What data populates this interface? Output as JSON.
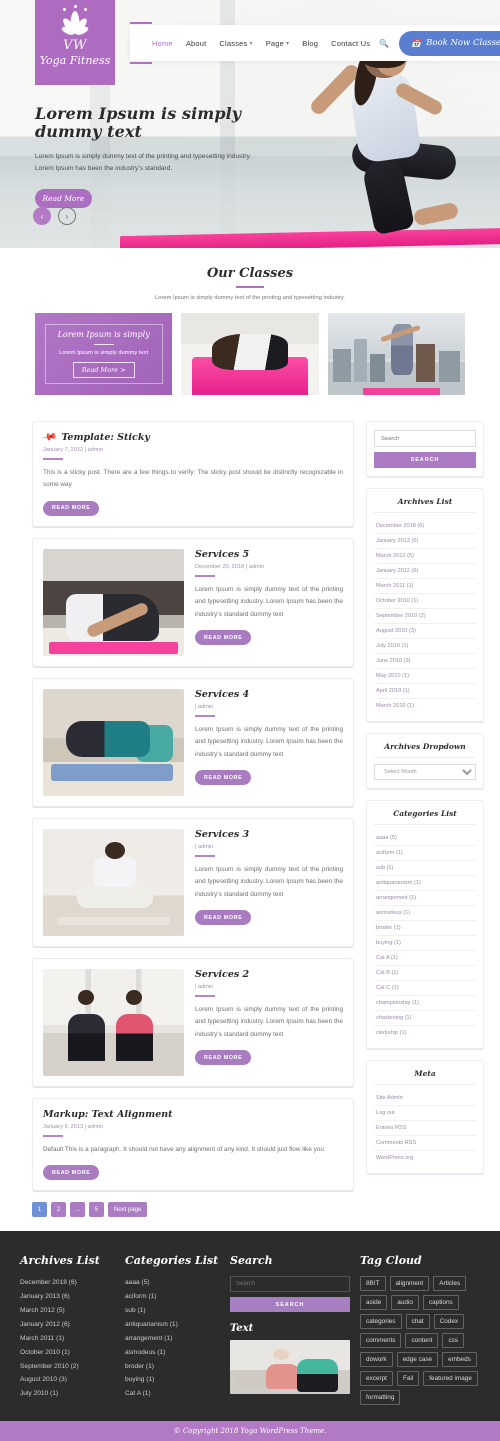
{
  "site": {
    "logo_line1": "VW",
    "logo_line2": "Yoga Fitness",
    "logo_icon": "lotus-icon"
  },
  "nav": {
    "items": [
      {
        "label": "Home",
        "active": true,
        "has_caret": false
      },
      {
        "label": "About",
        "active": false,
        "has_caret": false
      },
      {
        "label": "Classes",
        "active": false,
        "has_caret": true
      },
      {
        "label": "Page",
        "active": false,
        "has_caret": true
      },
      {
        "label": "Blog",
        "active": false,
        "has_caret": false
      },
      {
        "label": "Contact Us",
        "active": false,
        "has_caret": false
      }
    ],
    "search_icon": "search-icon",
    "cta_label": "Book Now Classes",
    "cta_icon": "calendar-icon",
    "cta_color": "#5a7fd0",
    "active_color": "#b06fc4"
  },
  "hero": {
    "title": "Lorem Ipsum is simply dummy text",
    "sub_line1": "Lorem Ipsum is simply dummy text of the printing and typesetting industry.",
    "sub_line2": "Lorem Ipsum has been the industry's standard.",
    "button": "Read More",
    "prev_icon": "chevron-left-icon",
    "next_icon": "chevron-right-icon"
  },
  "classes": {
    "title": "Our Classes",
    "subtitle": "Lorem Ipsum is simply dummy text of the printing and typesetting industry.",
    "card": {
      "title": "Lorem Ipsum is simply",
      "subtitle": "Lorem Ipsum is simply dummy text",
      "button": "Read More >"
    }
  },
  "posts": [
    {
      "sticky": true,
      "icon": "pin-icon",
      "title": "Template: Sticky",
      "meta": "January 7, 2012 |  admin",
      "body": "This is a sticky post. There are a few things to verify: The sticky post should be distinctly recognizable in some way",
      "read_more": "READ MORE",
      "thumb": null
    },
    {
      "sticky": false,
      "title": "Services 5",
      "meta": "December 20, 2018 | admin",
      "body": "Lorem Ipsum is simply dummy text of the printing and typesetting industry. Lorem Ipsum has been the industry's standard dummy text",
      "read_more": "READ MORE",
      "thumb": "yoga-stretch-on-sofa-photo"
    },
    {
      "sticky": false,
      "title": "Services 4",
      "meta": "| admin",
      "body": "Lorem Ipsum is simply dummy text of the printing and typesetting industry. Lorem Ipsum has been the industry's standard dummy text",
      "read_more": "READ MORE",
      "thumb": "yoga-side-stretch-photo"
    },
    {
      "sticky": false,
      "title": "Services 3",
      "meta": "| admin",
      "body": "Lorem Ipsum is simply dummy text of the printing and typesetting industry. Lorem Ipsum has been the industry's standard dummy text",
      "read_more": "READ MORE",
      "thumb": "yoga-meditation-photo"
    },
    {
      "sticky": false,
      "title": "Services 2",
      "meta": "| admin",
      "body": "Lorem Ipsum is simply dummy text of the printing and typesetting industry. Lorem Ipsum has been the industry's standard dummy text",
      "read_more": "READ MORE",
      "thumb": "two-women-meditating-photo"
    },
    {
      "sticky": false,
      "title": "Markup: Text Alignment",
      "meta": "January 9, 2013 |  admin",
      "body": "Default This is a paragraph. It should not have any alignment of any kind. It should just flow like you",
      "read_more": "READ MORE",
      "thumb": null
    }
  ],
  "pagination": {
    "pages": [
      "1",
      "2",
      "…",
      "5"
    ],
    "current": "1",
    "next_label": "Next page"
  },
  "sidebar": {
    "search": {
      "placeholder": "Search",
      "button": "SEARCH"
    },
    "archives": {
      "title": "Archives List",
      "items": [
        "December 2018 (6)",
        "January 2013 (6)",
        "March 2012 (5)",
        "January 2012 (6)",
        "March 2011 (1)",
        "October 2010 (1)",
        "September 2010 (2)",
        "August 2010 (3)",
        "July 2010 (1)",
        "June 2010 (3)",
        "May 2010 (1)",
        "April 2010 (1)",
        "March 2010 (1)"
      ]
    },
    "archives_dropdown": {
      "title": "Archives Dropdown",
      "selected": "Select Month"
    },
    "categories": {
      "title": "Categories List",
      "items": [
        "aaaa (5)",
        "aciform (1)",
        "sub (1)",
        "antiquarianism (1)",
        "arrangement (1)",
        "asmodeus (1)",
        "broder (1)",
        "buying (1)",
        "Cat A (1)",
        "Cat B (1)",
        "Cat C (1)",
        "championship (1)",
        "chastening (1)",
        "clerkship (1)"
      ]
    },
    "meta": {
      "title": "Meta",
      "items": [
        "Site Admin",
        "Log out",
        "Entries RSS",
        "Comments RSS",
        "WordPress.org"
      ]
    }
  },
  "footer": {
    "archives": {
      "title": "Archives List",
      "items": [
        "December 2018 (6)",
        "January 2013 (6)",
        "March 2012 (5)",
        "January 2012 (6)",
        "March 2011 (1)",
        "October 2010 (1)",
        "September 2010 (2)",
        "August 2010 (3)",
        "July 2010 (1)"
      ]
    },
    "categories": {
      "title": "Categories List",
      "items": [
        "aaaa (5)",
        "aciform (1)",
        "sub (1)",
        "antiquarianism (1)",
        "arrangement (1)",
        "asmodeus (1)",
        "broder (1)",
        "buying (1)",
        "Cat A (1)"
      ]
    },
    "search": {
      "title": "Search",
      "placeholder": "Search",
      "button": "SEARCH"
    },
    "text_widget": {
      "title": "Text",
      "image": "yoga-class-meditation-photo"
    },
    "tag_cloud": {
      "title": "Tag Cloud",
      "tags": [
        "8BIT",
        "alignment",
        "Articles",
        "aside",
        "audio",
        "captions",
        "categories",
        "chat",
        "Codex",
        "comments",
        "content",
        "css",
        "dowork",
        "edge case",
        "embeds",
        "excerpt",
        "Fail",
        "featured image",
        "formatting"
      ]
    },
    "copyright": "© Copyright 2018 Yoga WordPress Theme.",
    "copyright_bg": "#b27ac4"
  }
}
